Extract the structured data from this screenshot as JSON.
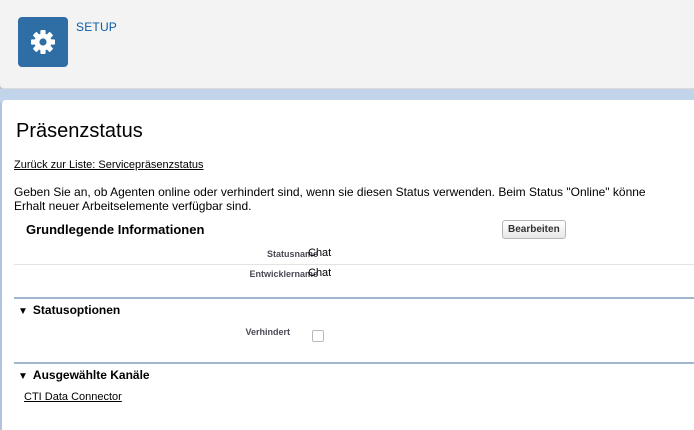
{
  "header": {
    "setup_label": "SETUP",
    "setup_icon": "gear-icon"
  },
  "page": {
    "title": "Präsenzstatus",
    "back_link": "Zurück zur Liste: Servicepräsenzstatus",
    "description": "Geben Sie an, ob Agenten online oder verhindert sind, wenn sie diesen Status verwenden. Beim Status \"Online\" könne",
    "description_line2": "Erhalt neuer Arbeitselemente verfügbar sind."
  },
  "basic_info": {
    "title": "Grundlegende Informationen",
    "edit_button": "Bearbeiten",
    "fields": [
      {
        "label": "Statusname",
        "value": "Chat"
      },
      {
        "label": "Entwicklername",
        "value": "Chat"
      }
    ]
  },
  "status_options": {
    "title": "Statusoptionen",
    "toggle_glyph": "▼",
    "busy_label": "Verhindert",
    "busy_checked": false
  },
  "channels": {
    "title": "Ausgewählte Kanäle",
    "toggle_glyph": "▼",
    "items": [
      "CTI Data Connector"
    ]
  },
  "colors": {
    "accent": "#2f6ea5",
    "link": "#0b5cab",
    "divider": "#a3b6cf"
  }
}
